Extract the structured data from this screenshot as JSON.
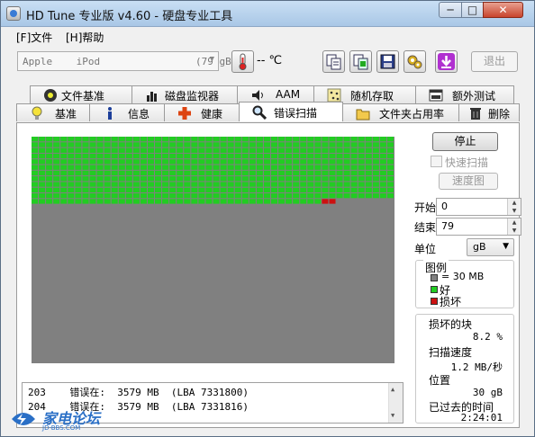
{
  "window": {
    "title": "HD Tune 专业版 v4.60 - 硬盘专业工具"
  },
  "titlebar_buttons": {
    "minimize": "─",
    "maximize": "□",
    "close": "✕"
  },
  "menu": {
    "file": "[F]文件",
    "help": "[H]帮助"
  },
  "toolbar": {
    "device": "Apple    iPod                (79 gB)",
    "temperature": "-- ℃",
    "exit_label": "退出",
    "icons": [
      "thermometer-icon",
      "copy-text-icon",
      "copy-screenshot-icon",
      "save-icon",
      "options-icon",
      "download-icon"
    ]
  },
  "tabs": {
    "top": [
      "文件基准",
      "磁盘监视器",
      "AAM",
      "随机存取",
      "额外测试"
    ],
    "bottom": [
      "基准",
      "信息",
      "健康",
      "错误扫描",
      "文件夹占用率",
      "删除"
    ],
    "active": "错误扫描"
  },
  "scan": {
    "stop_label": "停止",
    "quick_scan_label": "快速扫描",
    "speed_map_label": "速度图",
    "start_label": "开始",
    "start_value": "0",
    "end_label": "结束",
    "end_value": "79",
    "unit_label": "单位",
    "unit_value": "gB",
    "legend": {
      "title": "图例",
      "block": "= 30 MB",
      "good": "好",
      "damaged": "损坏"
    },
    "stats": {
      "damaged_blocks_label": "损坏的块",
      "damaged_blocks_value": "8.2 %",
      "scan_speed_label": "扫描速度",
      "scan_speed_value": "1.2 MB/秒",
      "position_label": "位置",
      "position_value": "30 gB",
      "elapsed_label": "已过去的时间",
      "elapsed_value": "2:24:01"
    },
    "grid": {
      "columns": 50,
      "rows": 40,
      "good_rows": 11,
      "partial_good_cols": 40,
      "damaged_start_col": 40,
      "damaged_end_col": 42,
      "progress_percent": 37.5
    },
    "log": [
      {
        "index": "203",
        "text": "错误在:  3579 MB  (LBA 7331800)"
      },
      {
        "index": "204",
        "text": "错误在:  3579 MB  (LBA 7331816)"
      }
    ]
  },
  "colors": {
    "good": "#22cc22",
    "damaged": "#cc1111",
    "unscanned": "#808080"
  },
  "watermark": {
    "text": "家电论坛",
    "sub": "JD-BBS.COM"
  }
}
